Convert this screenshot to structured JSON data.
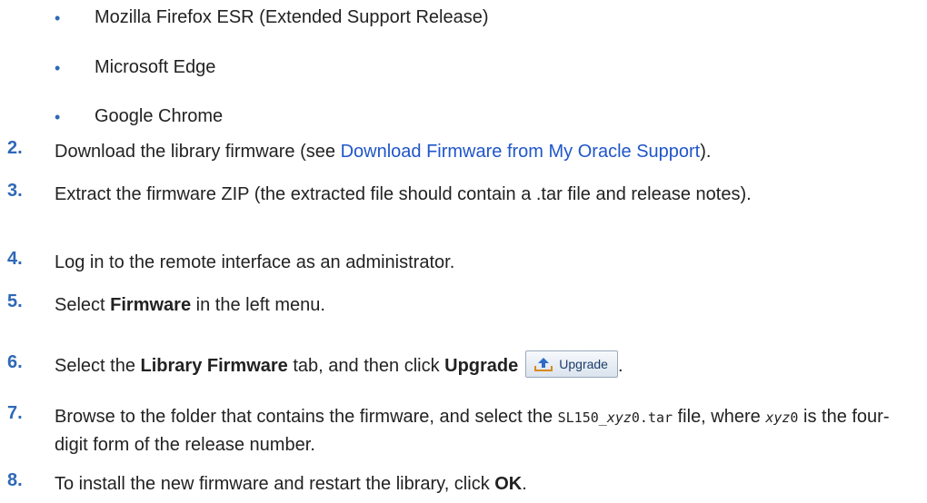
{
  "bullets": [
    "Mozilla Firefox ESR (Extended Support Release)",
    "Microsoft Edge",
    "Google Chrome"
  ],
  "bullet_glyph": "•",
  "steps": {
    "s2": {
      "num": "2.",
      "pre": "Download the library firmware (see ",
      "link": "Download Firmware from My Oracle Support",
      "post": ")."
    },
    "s3": {
      "num": "3.",
      "text": "Extract the firmware ZIP (the extracted file should contain a .tar file and release notes)."
    },
    "s4": {
      "num": "4.",
      "text": "Log in to the remote interface as an administrator."
    },
    "s5": {
      "num": "5.",
      "pre": "Select ",
      "bold": "Firmware",
      "post": " in the left menu."
    },
    "s6": {
      "num": "6.",
      "pre": "Select the ",
      "bold1": "Library Firmware",
      "mid": " tab, and then click ",
      "bold2": "Upgrade",
      "post": ".",
      "button_label": "Upgrade"
    },
    "s7": {
      "num": "7.",
      "pre": "Browse to the folder that contains the firmware, and select the ",
      "code_pre": "SL150_",
      "code_var": "xyz",
      "code_post": "0.tar",
      "mid": " file, where ",
      "var2": "xyz",
      "var2_post": "0",
      "post": " is the four-digit form of the release number."
    },
    "s8": {
      "num": "8.",
      "pre": "To install the new firmware and restart the library, click ",
      "bold": "OK",
      "post": "."
    }
  },
  "colors": {
    "accent": "#2e68b8",
    "link": "#1f56c9"
  },
  "icons": {
    "upgrade": "upload-arrow-icon"
  }
}
